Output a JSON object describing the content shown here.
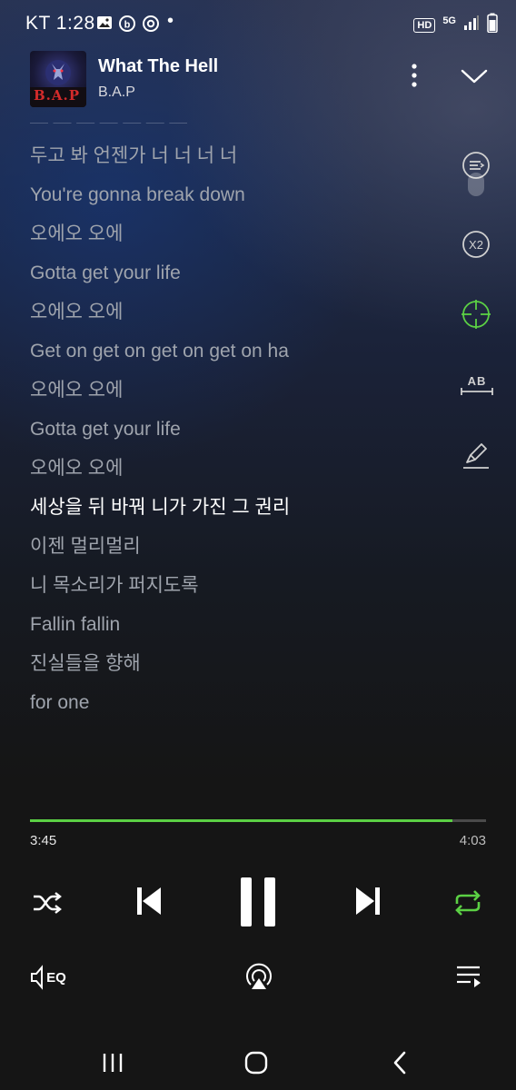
{
  "status_bar": {
    "carrier": "KT 1:28",
    "dot": "•",
    "icons": [
      "gallery-icon",
      "b-app-icon",
      "chrome-icon",
      "hd-icon",
      "5g-icon",
      "signal-icon",
      "battery-icon"
    ],
    "hd_label": "HD",
    "network_label": "5G"
  },
  "player": {
    "title": "What The Hell",
    "artist": "B.A.P",
    "album_art_text": "B.A.P"
  },
  "lyrics": {
    "lines": [
      "두고 봐 언젠가 너 너 너 너",
      "You're gonna break down",
      "오에오 오에",
      "Gotta get your life",
      "오에오 오에",
      "Get on get on get on get on ha",
      "오에오 오에",
      "Gotta get your life",
      "오에오 오에",
      "세상을 뒤 바꿔 니가 가진 그 권리",
      "이젠 멀리멀리",
      "니 목소리가 퍼지도록",
      "Fallin fallin",
      "진실들을 향해",
      "for one"
    ],
    "active_index": 9
  },
  "side_tools": {
    "speed_label": "X2",
    "ab_label": "AB"
  },
  "progress": {
    "current": "3:45",
    "total": "4:03",
    "fraction": 0.926
  },
  "colors": {
    "accent": "#5bd044",
    "lyric_inactive": "#9fa4ad",
    "lyric_active": "#ffffff"
  },
  "bottom_tools": {
    "eq_label": "EQ"
  }
}
